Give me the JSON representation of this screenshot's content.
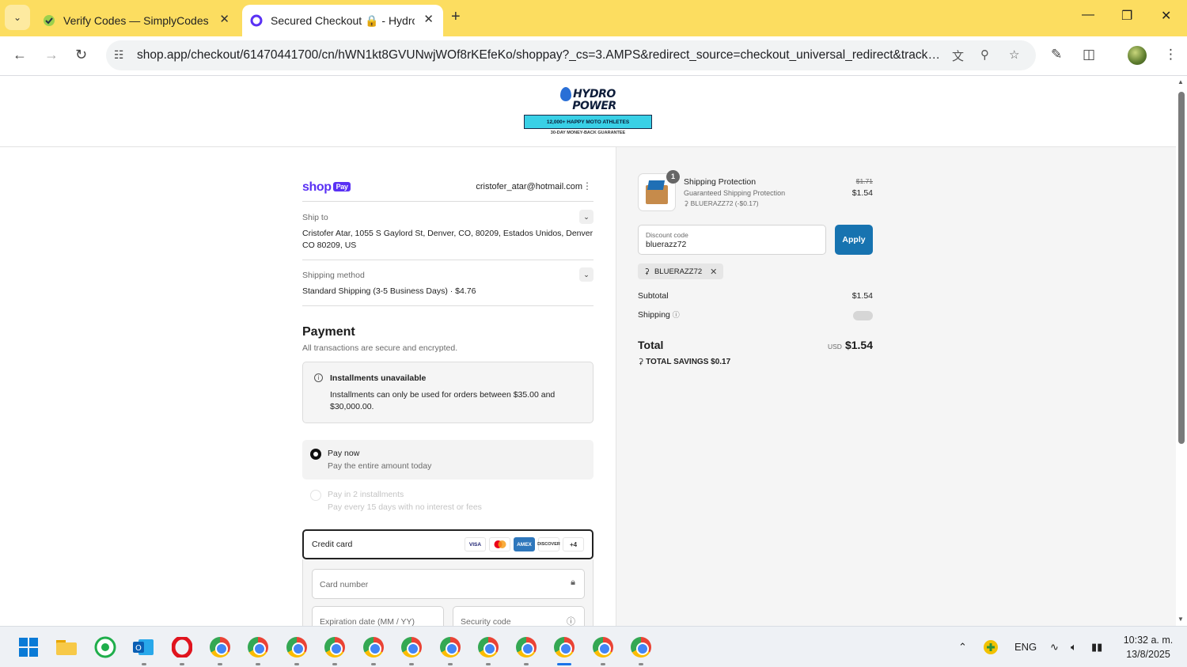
{
  "browser": {
    "tabs": [
      {
        "title": "Verify Codes — SimplyCodes",
        "icon": "simplycodes-icon",
        "active": false
      },
      {
        "title": "Secured Checkout 🔒 - Hydro P",
        "icon": "shop-icon",
        "active": true
      }
    ],
    "url": "shop.app/checkout/61470441700/cn/hWN1kt8GVUNwjWOf8rKEfeKo/shoppay?_cs=3.AMPS&redirect_source=checkout_universal_redirect&tracking_..."
  },
  "store": {
    "brand_line1": "HYDRO",
    "brand_line2": "POWER",
    "banner": "12,000+ HAPPY MOTO ATHLETES",
    "guarantee": "30-DAY MONEY-BACK GUARANTEE"
  },
  "checkout": {
    "shop_logo": "shop",
    "shop_pay_badge": "Pay",
    "email": "cristofer_atar@hotmail.com",
    "ship_to_label": "Ship to",
    "ship_to_value": "Cristofer Atar, 1055 S Gaylord St, Denver, CO, 80209, Estados Unidos, Denver CO 80209, US",
    "shipping_method_label": "Shipping method",
    "shipping_method_value": "Standard Shipping (3-5 Business Days) · $4.76",
    "payment_title": "Payment",
    "payment_subtitle": "All transactions are secure and encrypted.",
    "notice_title": "Installments unavailable",
    "notice_text": "Installments can only be used for orders between $35.00 and $30,000.00.",
    "options": [
      {
        "title": "Pay now",
        "sub": "Pay the entire amount today",
        "selected": true,
        "disabled": false
      },
      {
        "title": "Pay in 2 installments",
        "sub": "Pay every 15 days with no interest or fees",
        "selected": false,
        "disabled": true
      }
    ],
    "credit_card_label": "Credit card",
    "card_brands": [
      "VISA",
      "mastercard",
      "AMEX",
      "DISCOVER"
    ],
    "more_cards": "+4",
    "card_number_placeholder": "Card number",
    "expiry_placeholder": "Expiration date (MM / YY)",
    "security_placeholder": "Security code"
  },
  "summary": {
    "item_qty": "1",
    "item_name": "Shipping Protection",
    "item_variant": "Guaranteed Shipping Protection",
    "item_discount": "BLUERAZZ72 (-$0.17)",
    "item_old_price": "$1.71",
    "item_price": "$1.54",
    "discount_label": "Discount code",
    "discount_value": "bluerazz72",
    "apply_label": "Apply",
    "applied_code": "BLUERAZZ72",
    "subtotal_label": "Subtotal",
    "subtotal_value": "$1.54",
    "shipping_label": "Shipping",
    "total_label": "Total",
    "total_currency": "USD",
    "total_value": "$1.54",
    "savings": "TOTAL SAVINGS  $0.17"
  },
  "taskbar": {
    "language": "ENG",
    "time": "10:32 a. m.",
    "date": "13/8/2025"
  },
  "colors": {
    "tabbar": "#fcdd60",
    "shop_purple": "#5a31f4",
    "apply_blue": "#1773b0"
  }
}
